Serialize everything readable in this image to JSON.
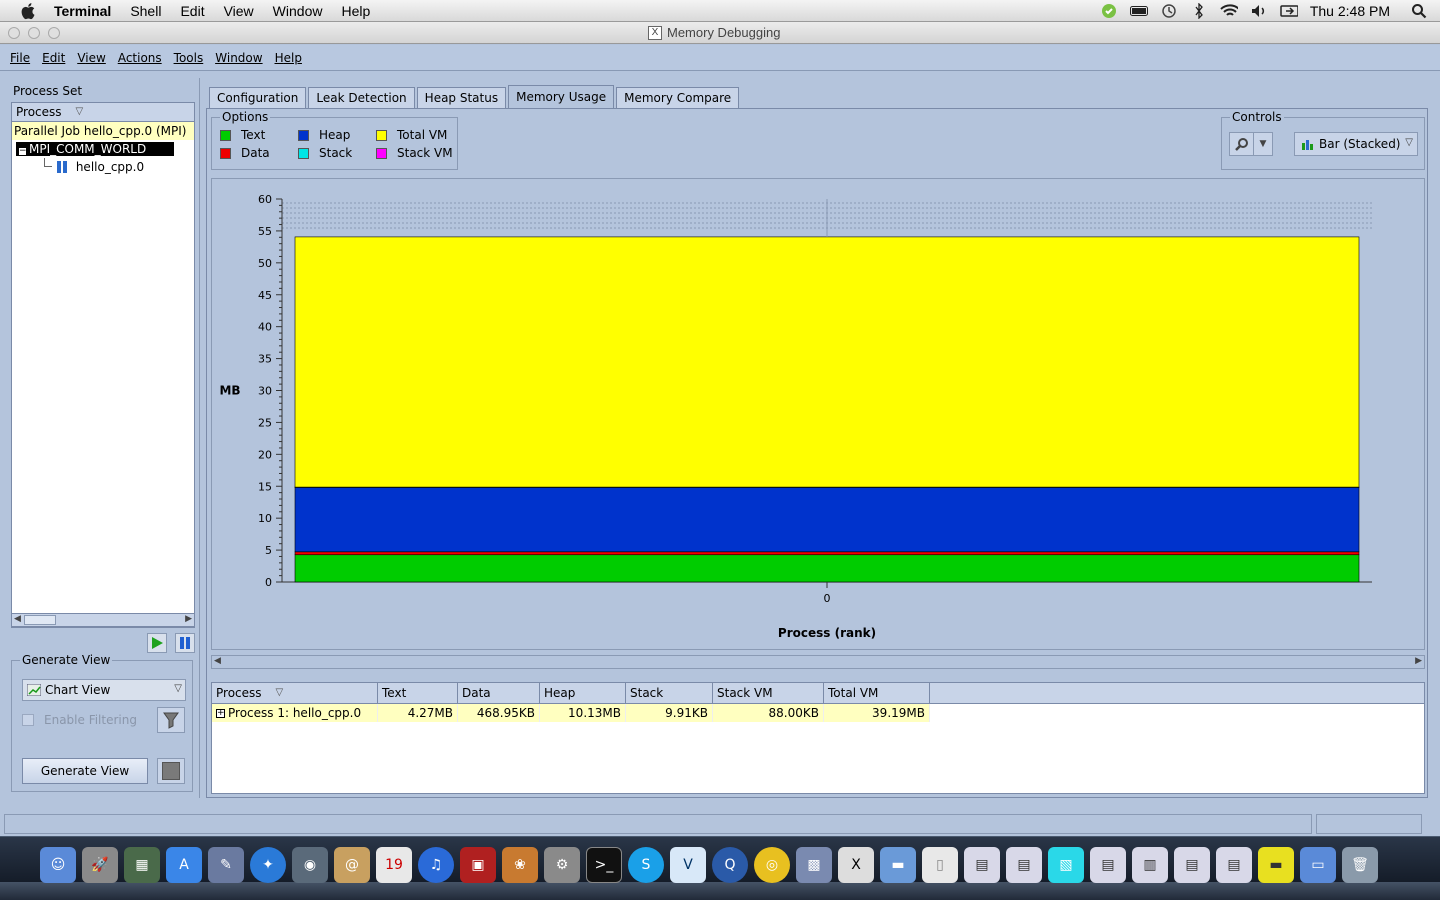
{
  "macbar": {
    "app_name": "Terminal",
    "menus": [
      "Shell",
      "Edit",
      "View",
      "Window",
      "Help"
    ],
    "clock": "Thu 2:48 PM"
  },
  "window": {
    "title": "Memory Debugging"
  },
  "app_menu": [
    "File",
    "Edit",
    "View",
    "Actions",
    "Tools",
    "Window",
    "Help"
  ],
  "left": {
    "process_set_label": "Process Set",
    "tree_header": "Process",
    "job_label": "Parallel Job hello_cpp.0 (MPI)",
    "world_label": "MPI_COMM_WORLD",
    "process_label": "hello_cpp.0",
    "generate_view_label": "Generate View",
    "view_combo": "Chart View",
    "enable_filtering": "Enable Filtering",
    "generate_button": "Generate View"
  },
  "tabs": [
    {
      "label": "Configuration",
      "active": false
    },
    {
      "label": "Leak Detection",
      "active": false
    },
    {
      "label": "Heap Status",
      "active": false
    },
    {
      "label": "Memory Usage",
      "active": true
    },
    {
      "label": "Memory Compare",
      "active": false
    }
  ],
  "options": {
    "label": "Options",
    "legend": [
      {
        "name": "Text",
        "color": "#00cc00"
      },
      {
        "name": "Data",
        "color": "#ee0000"
      },
      {
        "name": "Heap",
        "color": "#0033cc"
      },
      {
        "name": "Stack",
        "color": "#00e5e5"
      },
      {
        "name": "Total VM",
        "color": "#ffff00"
      },
      {
        "name": "Stack VM",
        "color": "#ff00ff"
      }
    ]
  },
  "controls": {
    "label": "Controls",
    "chart_type": "Bar (Stacked)"
  },
  "chart_data": {
    "type": "bar",
    "stacked": true,
    "categories": [
      "0"
    ],
    "xlabel": "Process (rank)",
    "ylabel": "MB",
    "ylim": [
      0,
      60
    ],
    "yticks": [
      0,
      5,
      10,
      15,
      20,
      25,
      30,
      35,
      40,
      45,
      50,
      55,
      60
    ],
    "series": [
      {
        "name": "Text",
        "color": "#00cc00",
        "values": [
          4.27
        ]
      },
      {
        "name": "Data",
        "color": "#ee0000",
        "values": [
          0.46
        ]
      },
      {
        "name": "Heap",
        "color": "#0033cc",
        "values": [
          10.13
        ]
      },
      {
        "name": "Stack",
        "color": "#00e5e5",
        "values": [
          0.01
        ]
      },
      {
        "name": "Total VM",
        "color": "#ffff00",
        "values": [
          39.19
        ]
      }
    ]
  },
  "table": {
    "columns": [
      "Process",
      "Text",
      "Data",
      "Heap",
      "Stack",
      "Stack VM",
      "Total VM"
    ],
    "rows": [
      [
        "Process 1: hello_cpp.0",
        "4.27MB",
        "468.95KB",
        "10.13MB",
        "9.91KB",
        "88.00KB",
        "39.19MB"
      ]
    ]
  }
}
